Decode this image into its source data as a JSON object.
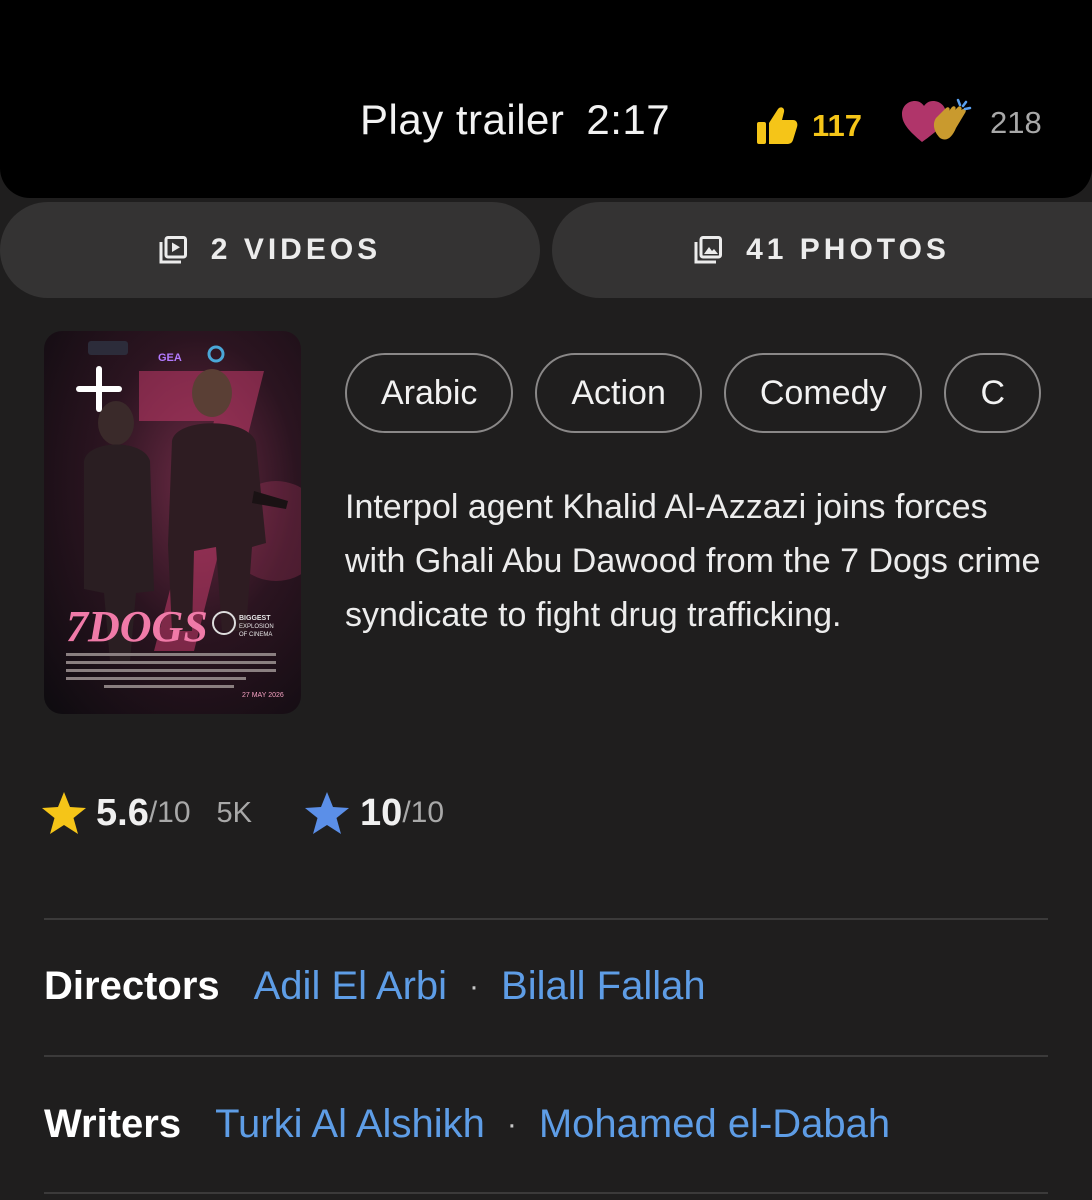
{
  "trailer": {
    "play_label": "Play trailer",
    "duration": "2:17",
    "like_count": "117",
    "reaction_count": "218"
  },
  "media": {
    "videos_label": "2 VIDEOS",
    "photos_label": "41 PHOTOS"
  },
  "poster": {
    "title_text": "7DOGS",
    "release_date": "27 MAY 2026",
    "badge_text": "BIGGEST EXPLOSION IN THE HISTORY OF CINEMA"
  },
  "genres": [
    "Arabic",
    "Action",
    "Comedy",
    "C"
  ],
  "plot": "Interpol agent Khalid Al-Azzazi joins forces with Ghali Abu Dawood from the 7 Dogs crime syndicate to fight drug trafficking.",
  "ratings": {
    "imdb_score": "5.6",
    "imdb_max": "/10",
    "imdb_count": "5K",
    "user_score": "10",
    "user_max": "/10"
  },
  "credits": {
    "directors_label": "Directors",
    "directors": [
      "Adil El Arbi",
      "Bilall Fallah"
    ],
    "writers_label": "Writers",
    "writers": [
      "Turki Al Alshikh",
      "Mohamed el-Dabah"
    ],
    "separator": "·"
  },
  "colors": {
    "accent_gold": "#f5c518",
    "link_blue": "#5e9de6",
    "user_star_blue": "#5b8fe8"
  }
}
